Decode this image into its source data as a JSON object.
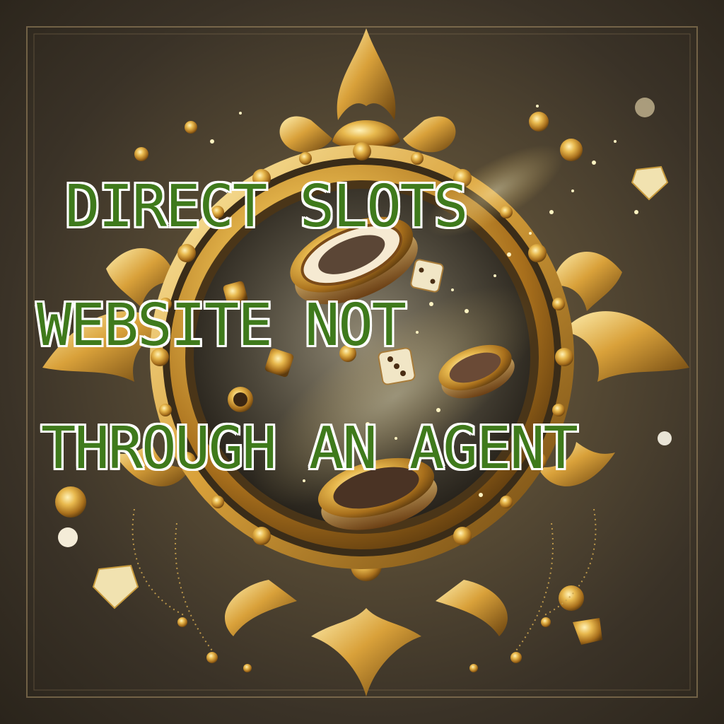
{
  "headline": {
    "line1": "DIRECT SLOTS",
    "line2": "WEBSITE NOT",
    "line3": "THROUGH AN AGENT"
  },
  "colors": {
    "text": "#3f7a1c",
    "outline": "#ffffff",
    "gold": "#d9a93c",
    "background": "#4a4030"
  }
}
